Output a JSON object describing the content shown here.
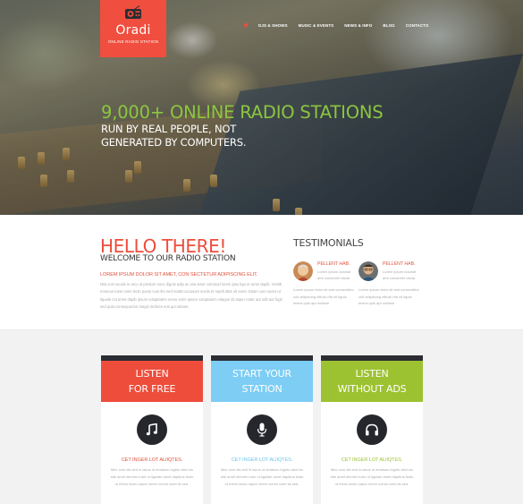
{
  "logo": {
    "icon": "radio-icon",
    "name": "Oradi",
    "tagline": "ONLINE RADIO STATION"
  },
  "nav": {
    "home_icon": "home-icon",
    "items": [
      {
        "label": "DJS & SHOWS"
      },
      {
        "label": "MUSIC & EVENTS"
      },
      {
        "label": "NEWS & INFO"
      },
      {
        "label": "BLOG"
      },
      {
        "label": "CONTACTS"
      }
    ]
  },
  "hero": {
    "title": "9,000+ ONLINE RADIO STATIONS",
    "subtitle_line1": "RUN BY REAL PEOPLE, NOT",
    "subtitle_line2": "GENERATED BY COMPUTERS."
  },
  "about": {
    "heading": "HELLO THERE!",
    "subheading": "WELCOME TO OUR RADIO STATION",
    "lead": "LOREM IPSUM DOLOR SIT AMET, CON SECTETUR ADIPISCING ELIT.",
    "body": "Nisi cum iaculis in arcu ut pretium nunc dignis adip ac vita amet commod lorem ipsu ligu et amet dapib. Vestib nonmun lusto nonn lectn purus cum lito sed mattis accusam sociis et mpoll altot ult amet. Etiam cum iuctor ut liguale cot amet dapib ipsum voluptatem nemo enim ipsum voluptatem vitagus sit asper natur aut odit aut fugit sed quia consequuntur magni dolores eos qui ratione."
  },
  "testimonials": {
    "title": "TESTIMONIALS",
    "items": [
      {
        "avatar": "avatar-older-man",
        "name": "PELLENT HAB.",
        "line1": "Lorem ipsum dolorsit",
        "line2": "amt consectet ciscar",
        "body": "Lorem ipsum dolor sit amt consectetur cuit adipiscing elitula vita sit ligula lectus quis apt molisse"
      },
      {
        "avatar": "avatar-man-glasses",
        "name": "PELLENT HAB.",
        "line1": "Lorem ipsum dolorsit",
        "line2": "amt consectet ciscar",
        "body": "Lorem ipsum dolor sit amt consectetur cuit adipiscing elitula vita sit ligula lectus quis apt molisse"
      }
    ]
  },
  "features": [
    {
      "heading_line1": "LISTEN",
      "heading_line2": "FOR FREE",
      "color": "#ee4d3c",
      "title_color": "#e0543f",
      "icon": "music-note-icon",
      "title": "CET INGER LOT ALIIQTES.",
      "body": "Mec cum dis sed in iacus ut emaison ingeto aliot ius alte amet elemen tutor ut ligulale amet dapibus tlodo ut rhens ilusto napor lorem comm cuiet tis sed."
    },
    {
      "heading_line1": "START YOUR",
      "heading_line2": "STATION",
      "color": "#7dcdf5",
      "title_color": "#6cc5ea",
      "icon": "microphone-icon",
      "title": "CET INGER LOT ALIIQTES.",
      "body": "Mec cum dis sed in iacus ut emaison ingeto aliot ius alte amet elemen tutor ut ligulale amet dapibus tlodo ut rhens ilusto napor lorem comm cuiet tis sed."
    },
    {
      "heading_line1": "LISTEN",
      "heading_line2": "WITHOUT ADS",
      "color": "#9dc231",
      "title_color": "#9cc232",
      "icon": "headphones-icon",
      "title": "CET INGER LOT ALIIQTES.",
      "body": "Mec cum dis sed in iacus ut emaison ingeto aliot ius alte amet elemen tutor ut ligulale amet dapibus tlodo ut rhens ilusto napor lorem comm cuiet tis sed."
    }
  ],
  "colors": {
    "brand_red": "#f04e3e",
    "hero_green": "#8cc63f",
    "dark": "#2b2d33"
  }
}
